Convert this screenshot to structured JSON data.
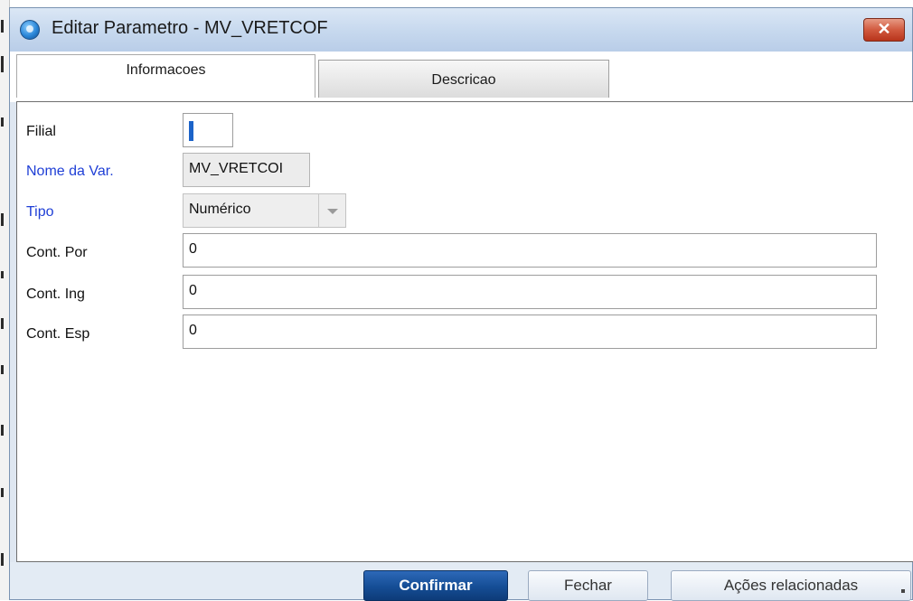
{
  "window": {
    "title": "Editar Parametro - MV_VRETCOF",
    "close_label": "✕"
  },
  "tabs": [
    {
      "label": "Informacoes",
      "active": true
    },
    {
      "label": "Descricao",
      "active": false
    }
  ],
  "form": {
    "filial": {
      "label": "Filial",
      "value": ""
    },
    "nome_var": {
      "label": "Nome da Var.",
      "value": "MV_VRETCOI"
    },
    "tipo": {
      "label": "Tipo",
      "value": "Numérico"
    },
    "cont_por": {
      "label": "Cont. Por",
      "value": "0"
    },
    "cont_ing": {
      "label": "Cont. Ing",
      "value": "0"
    },
    "cont_esp": {
      "label": "Cont. Esp",
      "value": "0"
    }
  },
  "buttons": {
    "confirm": "Confirmar",
    "close": "Fechar",
    "related": "Ações relacionadas"
  },
  "colors": {
    "required_label": "#1f3fd6",
    "primary_button": "#154d95",
    "close_button": "#d15a3f"
  }
}
